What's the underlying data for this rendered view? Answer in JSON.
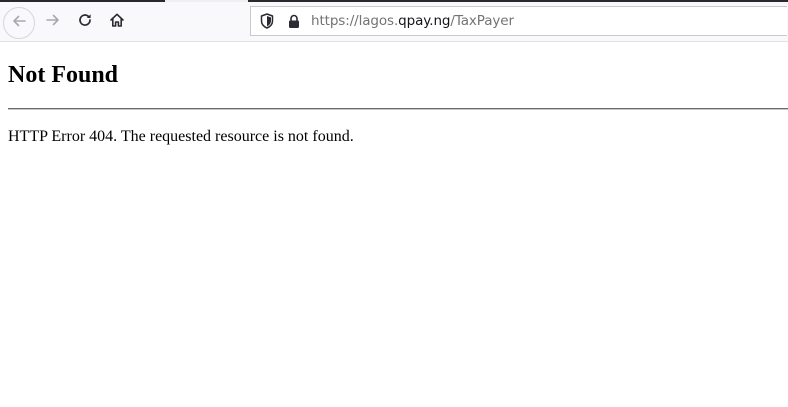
{
  "browser": {
    "url": {
      "scheme": "https://",
      "subdomain": "lagos.",
      "host": "qpay.ng",
      "path": "/TaxPayer"
    },
    "icons": {
      "back": "arrow-left-icon",
      "forward": "arrow-right-icon",
      "reload": "reload-icon",
      "home": "home-icon",
      "tracking_protection": "shield-icon",
      "secure": "lock-icon"
    }
  },
  "page": {
    "heading": "Not Found",
    "message": "HTTP Error 404. The requested resource is not found."
  }
}
